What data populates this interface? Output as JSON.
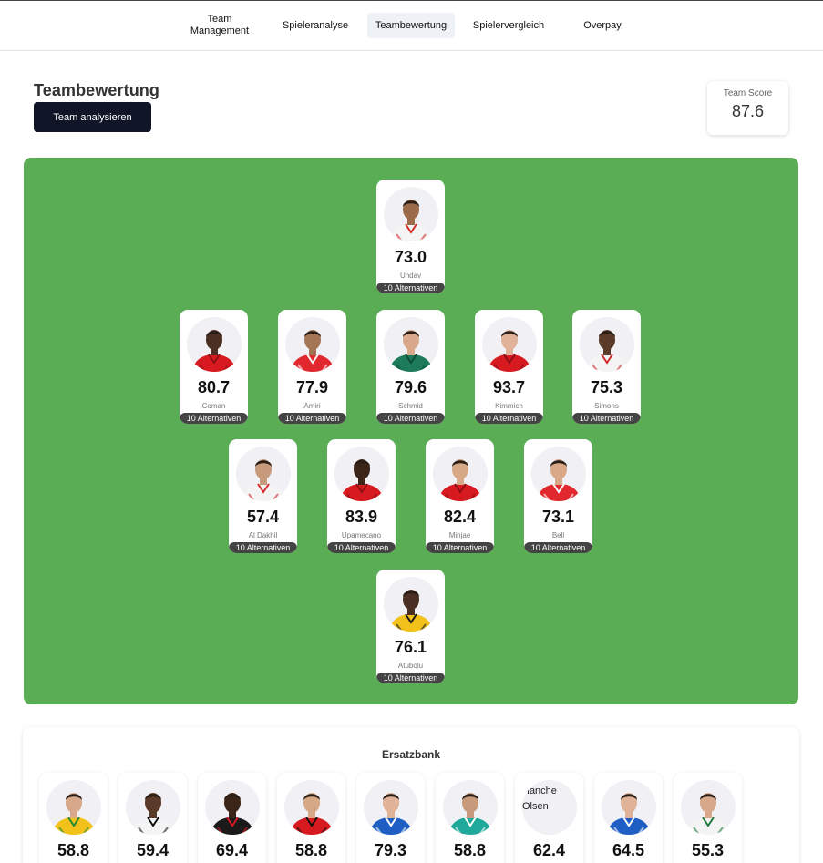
{
  "nav": {
    "items": [
      {
        "label": "Team\nManagement",
        "active": false
      },
      {
        "label": "Spieleranalyse",
        "active": false
      },
      {
        "label": "Teambewertung",
        "active": true
      },
      {
        "label": "Spielervergleich",
        "active": false
      },
      {
        "label": "Overpay",
        "active": false
      }
    ]
  },
  "header": {
    "title": "Teambewertung",
    "analyze_button": "Team analysieren"
  },
  "score": {
    "label": "Team Score",
    "value": "87.6"
  },
  "colors": {
    "pitch": "#5bad55",
    "button": "#111528",
    "alt_bar": "#444444"
  },
  "lineup": [
    {
      "name": "Undav",
      "rating": "73.0",
      "alternatives": "10 Alternativen",
      "kit": "#f4f4f4",
      "kit_accent": "#d12b2b",
      "skin": "#9a6a4a"
    },
    {
      "name": "Coman",
      "rating": "80.7",
      "alternatives": "10 Alternativen",
      "kit": "#d71920",
      "kit_accent": "#8e0f14",
      "skin": "#4a2f22"
    },
    {
      "name": "Amiri",
      "rating": "77.9",
      "alternatives": "10 Alternativen",
      "kit": "#e0282e",
      "kit_accent": "#ffffff",
      "skin": "#a57656"
    },
    {
      "name": "Schmid",
      "rating": "79.6",
      "alternatives": "10 Alternativen",
      "kit": "#1d7a5a",
      "kit_accent": "#0c4d39",
      "skin": "#d9a88a"
    },
    {
      "name": "Kimmich",
      "rating": "93.7",
      "alternatives": "10 Alternativen",
      "kit": "#d71920",
      "kit_accent": "#8e0f14",
      "skin": "#e0b298"
    },
    {
      "name": "Simons",
      "rating": "75.3",
      "alternatives": "10 Alternativen",
      "kit": "#f4f4f4",
      "kit_accent": "#d12b2b",
      "skin": "#5a3a28"
    },
    {
      "name": "Al Dakhil",
      "rating": "57.4",
      "alternatives": "10 Alternativen",
      "kit": "#f4f4f4",
      "kit_accent": "#d12b2b",
      "skin": "#c79a7c"
    },
    {
      "name": "Upamecano",
      "rating": "83.9",
      "alternatives": "10 Alternativen",
      "kit": "#d71920",
      "kit_accent": "#8e0f14",
      "skin": "#3b2519"
    },
    {
      "name": "Minjae",
      "rating": "82.4",
      "alternatives": "10 Alternativen",
      "kit": "#d71920",
      "kit_accent": "#8e0f14",
      "skin": "#d6a886"
    },
    {
      "name": "Bell",
      "rating": "73.1",
      "alternatives": "10 Alternativen",
      "kit": "#e0282e",
      "kit_accent": "#ffffff",
      "skin": "#d8a888"
    },
    {
      "name": "Atubolu",
      "rating": "76.1",
      "alternatives": "10 Alternativen",
      "kit": "#f2c21b",
      "kit_accent": "#1a1a1a",
      "skin": "#4a2f22"
    }
  ],
  "bench": {
    "title": "Ersatzbank",
    "players": [
      {
        "rating": "58.8",
        "kit": "#f2c21b",
        "kit_accent": "#1e8a3a",
        "skin": "#d7a88a",
        "image_alt": ""
      },
      {
        "rating": "59.4",
        "kit": "#f4f4f4",
        "kit_accent": "#111111",
        "skin": "#5a3a28",
        "image_alt": ""
      },
      {
        "rating": "69.4",
        "kit": "#1a1a1a",
        "kit_accent": "#d71920",
        "skin": "#3b2519",
        "image_alt": ""
      },
      {
        "rating": "58.8",
        "kit": "#d71920",
        "kit_accent": "#111111",
        "skin": "#d6a886",
        "image_alt": ""
      },
      {
        "rating": "79.3",
        "kit": "#1f5fc4",
        "kit_accent": "#ffffff",
        "skin": "#e0b298",
        "image_alt": ""
      },
      {
        "rating": "58.8",
        "kit": "#1fa99a",
        "kit_accent": "#ffffff",
        "skin": "#c79a7c",
        "image_alt": ""
      },
      {
        "rating": "62.4",
        "kit": "",
        "kit_accent": "",
        "skin": "",
        "image_alt": "Hanche Olsen"
      },
      {
        "rating": "64.5",
        "kit": "#1f5fc4",
        "kit_accent": "#ffffff",
        "skin": "#e0b298",
        "image_alt": ""
      },
      {
        "rating": "55.3",
        "kit": "#f4f4f4",
        "kit_accent": "#1e7a3a",
        "skin": "#d7a88a",
        "image_alt": ""
      }
    ]
  }
}
